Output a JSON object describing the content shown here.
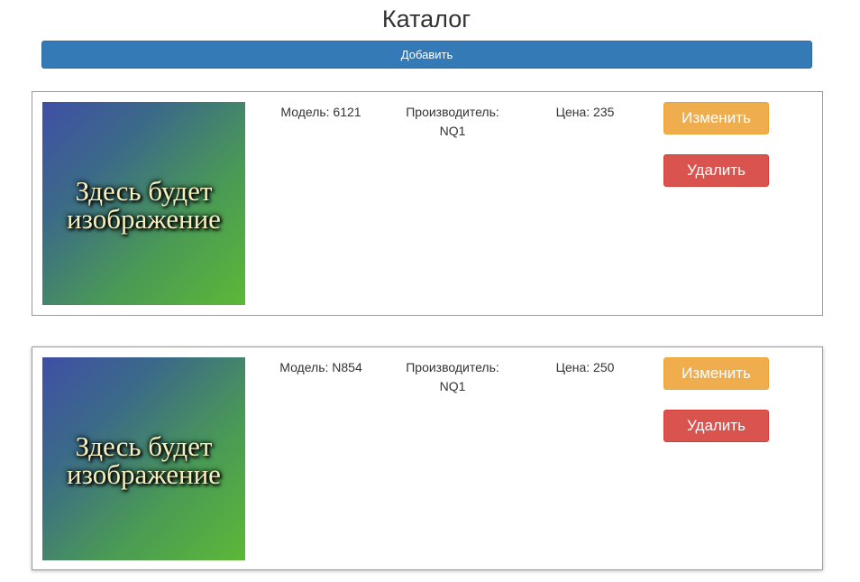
{
  "header": {
    "title": "Каталог",
    "add_label": "Добавить"
  },
  "products": [
    {
      "image_text_line1": "Здесь будет",
      "image_text_line2": "изображение",
      "model": "Модель: 6121",
      "manufacturer_line1": "Производитель:",
      "manufacturer_line2": "NQ1",
      "price": "Цена: 235",
      "edit_label": "Изменить",
      "delete_label": "Удалить"
    },
    {
      "image_text_line1": "Здесь будет",
      "image_text_line2": "изображение",
      "model": "Модель: N854",
      "manufacturer_line1": "Производитель:",
      "manufacturer_line2": "NQ1",
      "price": "Цена: 250",
      "edit_label": "Изменить",
      "delete_label": "Удалить"
    }
  ],
  "colors": {
    "primary": "#337ab7",
    "warning": "#f0ad4e",
    "danger": "#d9534f"
  }
}
